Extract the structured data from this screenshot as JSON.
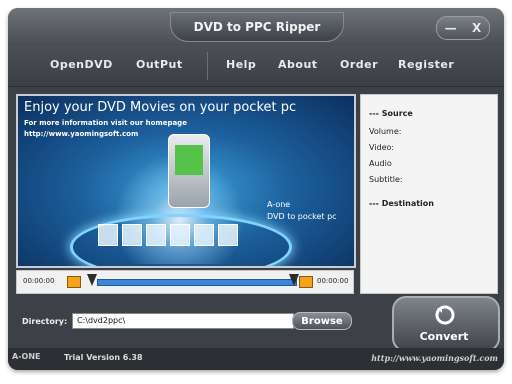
{
  "window": {
    "title": "DVD to PPC Ripper"
  },
  "window_controls": {
    "minimize_glyph": "—",
    "close_glyph": "X"
  },
  "menu": {
    "items": [
      {
        "label": "OpenDVD"
      },
      {
        "label": "OutPut"
      },
      {
        "label": "Help"
      },
      {
        "label": "About"
      },
      {
        "label": "Order"
      },
      {
        "label": "Register"
      }
    ]
  },
  "banner": {
    "headline": "Enjoy your DVD Movies on your pocket pc",
    "subline": "For more information visit our homepage",
    "url": "http://www.yaomingsoft.com",
    "brand": "A-one",
    "tagline": "DVD to pocket pc"
  },
  "info_panel": {
    "source_heading": "--- Source",
    "volume_label": "Volume:",
    "video_label": "Video:",
    "audio_label": "Audio",
    "subtitle_label": "Subtitle:",
    "destination_heading": "--- Destination"
  },
  "player": {
    "start_time": "00:00:00",
    "end_time": "00:00:00"
  },
  "directory": {
    "label": "Directory:",
    "value": "C:\\dvd2ppc\\"
  },
  "buttons": {
    "browse": "Browse",
    "convert": "Convert"
  },
  "status_bar": {
    "logo": "A-ONE",
    "version": "Trial Version 6.38",
    "url": "http://www.yaomingsoft.com"
  },
  "colors": {
    "window_bg": "#3d4147",
    "banner_blue": "#1c5f9c",
    "accent_orange": "#f6a31b"
  }
}
